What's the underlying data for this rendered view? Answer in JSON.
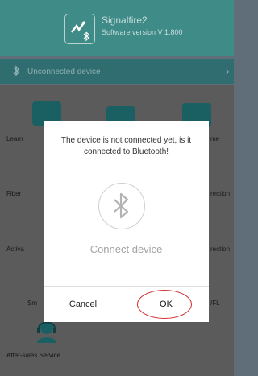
{
  "header": {
    "app_name": "Signalfire2",
    "version": "Software version V 1.800"
  },
  "connection_bar": {
    "status": "Unconnected device",
    "chevron": "›"
  },
  "grid_labels": {
    "learn": "Learn",
    "fiber": "Fiber",
    "activate": "Activa",
    "sm": "Sm",
    "me": "me",
    "correction_1": "rection",
    "correction_2": "rection",
    "vfl": "/FL"
  },
  "after_sales": {
    "label": "After-sales Service"
  },
  "dialog": {
    "message": "The device is not connected yet, is it connected to Bluetooth!",
    "connect_label": "Connect device",
    "cancel_label": "Cancel",
    "ok_label": "OK"
  },
  "colors": {
    "header_bg": "#3e8b87",
    "connection_bar_bg": "#2f6d70",
    "overlay_bg": "#5b5b5b",
    "dialog_bg": "#ffffff",
    "ok_highlight": "#d12a2a"
  },
  "icons": {
    "app_logo": "bluetooth-signal-logo-icon",
    "bluetooth": "bluetooth-icon",
    "connect": "bluetooth-circle-icon",
    "support": "customer-service-avatar-icon"
  }
}
